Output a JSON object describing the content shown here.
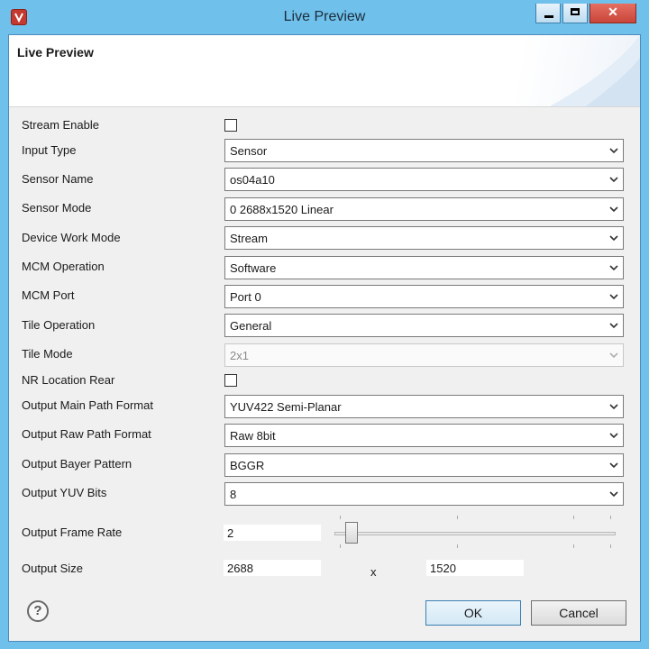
{
  "window": {
    "title": "Live Preview",
    "close_glyph": "✕"
  },
  "banner": {
    "title": "Live Preview"
  },
  "form": {
    "stream_enable": {
      "label": "Stream Enable",
      "checked": false
    },
    "input_type": {
      "label": "Input Type",
      "value": "Sensor"
    },
    "sensor_name": {
      "label": "Sensor Name",
      "value": "os04a10"
    },
    "sensor_mode": {
      "label": "Sensor Mode",
      "value": "0 2688x1520 Linear"
    },
    "device_work_mode": {
      "label": "Device Work Mode",
      "value": "Stream"
    },
    "mcm_operation": {
      "label": "MCM Operation",
      "value": "Software"
    },
    "mcm_port": {
      "label": "MCM Port",
      "value": "Port 0"
    },
    "tile_operation": {
      "label": "Tile Operation",
      "value": "General"
    },
    "tile_mode": {
      "label": "Tile Mode",
      "value": "2x1",
      "disabled": true
    },
    "nr_location_rear": {
      "label": "NR Location Rear",
      "checked": false
    },
    "output_main_path_format": {
      "label": "Output Main Path Format",
      "value": "YUV422 Semi-Planar"
    },
    "output_raw_path_format": {
      "label": "Output Raw Path Format",
      "value": "Raw 8bit"
    },
    "output_bayer_pattern": {
      "label": "Output Bayer Pattern",
      "value": "BGGR"
    },
    "output_yuv_bits": {
      "label": "Output YUV Bits",
      "value": "8"
    },
    "output_frame_rate": {
      "label": "Output Frame Rate",
      "value": "2"
    },
    "output_size": {
      "label": "Output Size",
      "width": "2688",
      "separator": "x",
      "height": "1520"
    }
  },
  "buttons": {
    "ok": "OK",
    "cancel": "Cancel",
    "help": "?"
  },
  "colors": {
    "titlebar": "#6fc0ea",
    "close_button": "#c9453a",
    "app_icon": "#c43a30",
    "client_bg": "#f0f0f0"
  }
}
